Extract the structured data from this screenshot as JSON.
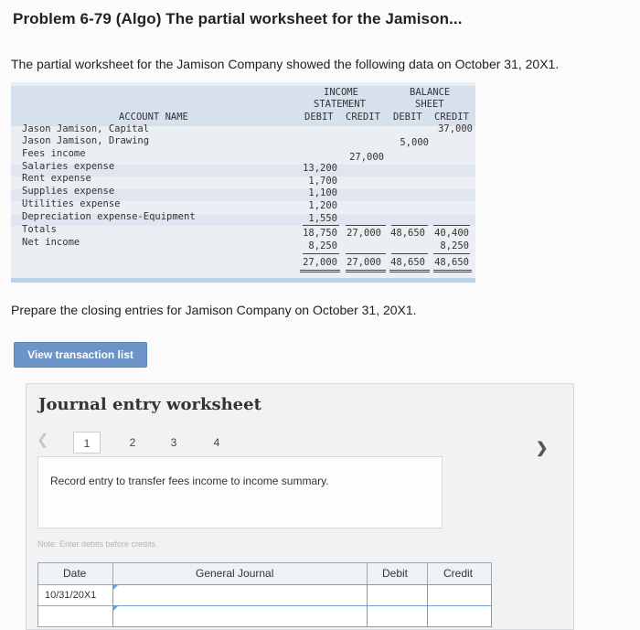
{
  "header": {
    "title": "Problem 6-79 (Algo) The partial worksheet for the Jamison...",
    "intro": "The partial worksheet for the Jamison Company showed the following data on October 31, 20X1."
  },
  "worksheet": {
    "income_statement_heading": [
      "INCOME",
      "STATEMENT"
    ],
    "balance_sheet_heading": [
      "BALANCE",
      "SHEET"
    ],
    "account_header": "ACCOUNT NAME",
    "col_debit_is": "DEBIT",
    "col_credit_is": "CREDIT",
    "col_debit_bs": "DEBIT",
    "col_credit_bs": "CREDIT",
    "rows": [
      {
        "account": "Jason Jamison, Capital",
        "is_debit": "",
        "is_credit": "",
        "bs_debit": "",
        "bs_credit": "37,000"
      },
      {
        "account": "Jason Jamison, Drawing",
        "is_debit": "",
        "is_credit": "",
        "bs_debit": "5,000",
        "bs_credit": ""
      },
      {
        "account": "Fees income",
        "is_debit": "",
        "is_credit": "27,000",
        "bs_debit": "",
        "bs_credit": ""
      },
      {
        "account": "Salaries expense",
        "is_debit": "13,200",
        "is_credit": "",
        "bs_debit": "",
        "bs_credit": ""
      },
      {
        "account": "Rent expense",
        "is_debit": "1,700",
        "is_credit": "",
        "bs_debit": "",
        "bs_credit": ""
      },
      {
        "account": "Supplies expense",
        "is_debit": "1,100",
        "is_credit": "",
        "bs_debit": "",
        "bs_credit": ""
      },
      {
        "account": "Utilities expense",
        "is_debit": "1,200",
        "is_credit": "",
        "bs_debit": "",
        "bs_credit": ""
      },
      {
        "account": "Depreciation expense-Equipment",
        "is_debit": "1,550",
        "is_credit": "",
        "bs_debit": "",
        "bs_credit": ""
      },
      {
        "account": "Totals",
        "is_debit": "18,750",
        "is_credit": "27,000",
        "bs_debit": "48,650",
        "bs_credit": "40,400"
      },
      {
        "account": "Net income",
        "is_debit": "8,250",
        "is_credit": "",
        "bs_debit": "",
        "bs_credit": "8,250"
      },
      {
        "account": "",
        "is_debit": "27,000",
        "is_credit": "27,000",
        "bs_debit": "48,650",
        "bs_credit": "48,650"
      }
    ]
  },
  "prepare_text": "Prepare the closing entries for Jamison Company on October 31, 20X1.",
  "view_transaction_button": "View transaction list",
  "journal": {
    "title": "Journal entry worksheet",
    "steps": [
      "1",
      "2",
      "3",
      "4"
    ],
    "active_step": "1",
    "instruction": "Record entry to transfer fees income to income summary.",
    "note": "Note: Enter debits before credits.",
    "columns": {
      "date": "Date",
      "general_journal": "General Journal",
      "debit": "Debit",
      "credit": "Credit"
    },
    "rows": [
      {
        "date": "10/31/20X1",
        "account": "",
        "debit": "",
        "credit": ""
      }
    ]
  }
}
